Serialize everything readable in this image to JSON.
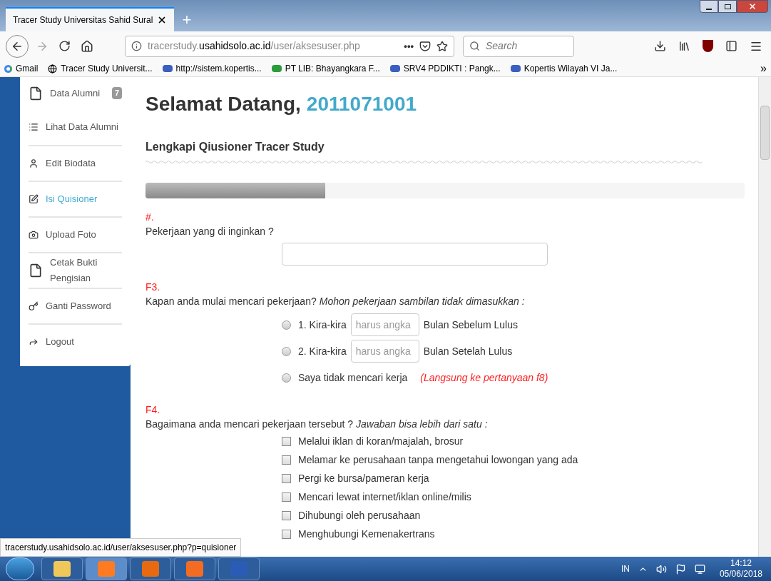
{
  "browser": {
    "tab_title": "Tracer Study Universitas Sahid Sural",
    "new_tab": "+",
    "url": {
      "prefix": "tracerstudy.",
      "domain": "usahidsolo.ac.id",
      "path": "/user/aksesuser.php"
    },
    "url_more": "•••",
    "search": {
      "placeholder": "Search"
    },
    "bookmarks": [
      "Gmail",
      "Tracer Study Universit...",
      "http://sistem.kopertis...",
      "PT LIB: Bhayangkara F...",
      "SRV4 PDDIKTI : Pangk...",
      "Kopertis Wilayah VI Ja..."
    ],
    "bookmarks_overflow": "»"
  },
  "sidebar": {
    "items": [
      {
        "label": "Data Alumni",
        "badge": "7",
        "selected": false
      },
      {
        "label": "Lihat Data Alumni",
        "selected": false
      },
      {
        "label": "Edit Biodata",
        "selected": false
      },
      {
        "label": "Isi Quisioner",
        "selected": true
      },
      {
        "label": "Upload Foto",
        "selected": false
      },
      {
        "label": "Cetak Bukti Pengisian",
        "selected": false
      },
      {
        "label": "Ganti Password",
        "selected": false
      },
      {
        "label": "Logout",
        "selected": false
      }
    ]
  },
  "main": {
    "greeting": "Selamat Datang,",
    "user_id": "2011071001",
    "section_title": "Lengkapi Qiusioner Tracer Study",
    "progress": {
      "level": 0.3
    },
    "questions": [
      {
        "number": "#.",
        "text": "Pekerjaan yang di inginkan ?",
        "kind": "text"
      },
      {
        "number": "F3.",
        "text": "Kapan anda mulai mencari pekerjaan?",
        "note": "Mohon pekerjaan sambilan tidak dimasukkan :",
        "kind": "radio",
        "options": [
          {
            "kind": "input",
            "label": "1. Kira-kira",
            "placeholder": "harus angka",
            "suffix": "Bulan Sebelum Lulus",
            "selected": false
          },
          {
            "kind": "input",
            "label": "2. Kira-kira",
            "placeholder": "harus angka",
            "suffix": "Bulan Setelah Lulus",
            "selected": false
          },
          {
            "kind": "plain",
            "label": "Saya tidak mencari kerja",
            "hint": "(Langsung ke pertanyaan f8)",
            "selected": false
          }
        ]
      },
      {
        "number": "F4.",
        "text": "Bagaimana anda mencari pekerjaan tersebut ?",
        "note": "Jawaban bisa lebih dari satu :",
        "kind": "checkbox",
        "options": [
          {
            "label": "Melalui iklan di koran/majalah, brosur",
            "checked": false
          },
          {
            "label": "Melamar ke perusahaan tanpa mengetahui lowongan yang ada",
            "checked": false
          },
          {
            "label": "Pergi ke bursa/pameran kerja",
            "checked": false
          },
          {
            "label": "Mencari lewat internet/iklan online/milis",
            "checked": false
          },
          {
            "label": "Dihubungi oleh perusahaan",
            "checked": false
          },
          {
            "label": "Menghubungi Kemenakertrans",
            "checked": false
          }
        ]
      }
    ]
  },
  "status_url": "tracerstudy.usahidsolo.ac.id/user/aksesuser.php?p=quisioner",
  "taskbar": {
    "language": "IN",
    "time": "14:12",
    "date": "05/06/2018"
  }
}
